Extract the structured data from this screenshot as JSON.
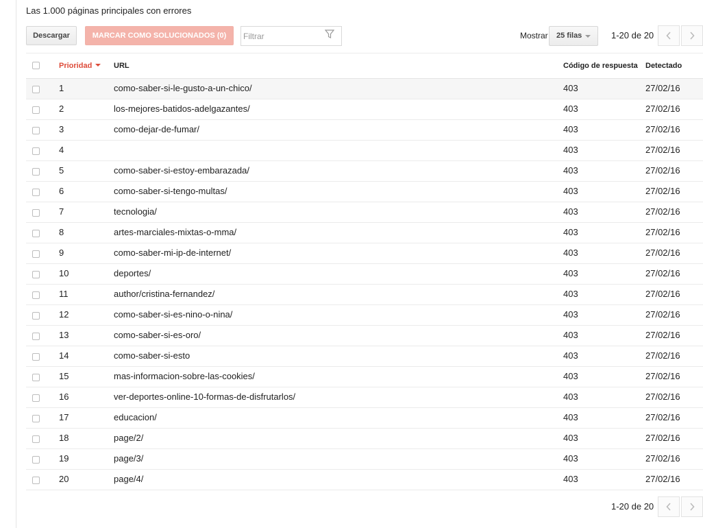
{
  "heading": "Las 1.000 páginas principales con errores",
  "toolbar": {
    "download_label": "Descargar",
    "mark_fixed_label": "MARCAR COMO SOLUCIONADOS (0)",
    "filter_placeholder": "Filtrar",
    "show_label": "Mostrar",
    "rows_value": "25 filas",
    "page_info": "1-20 de 20"
  },
  "table": {
    "headers": {
      "priority": "Prioridad",
      "url": "URL",
      "code": "Código de respuesta",
      "detected": "Detectado"
    },
    "rows": [
      {
        "priority": "1",
        "url": "como-saber-si-le-gusto-a-un-chico/",
        "code": "403",
        "detected": "27/02/16"
      },
      {
        "priority": "2",
        "url": "los-mejores-batidos-adelgazantes/",
        "code": "403",
        "detected": "27/02/16"
      },
      {
        "priority": "3",
        "url": "como-dejar-de-fumar/",
        "code": "403",
        "detected": "27/02/16"
      },
      {
        "priority": "4",
        "url": "",
        "code": "403",
        "detected": "27/02/16"
      },
      {
        "priority": "5",
        "url": "como-saber-si-estoy-embarazada/",
        "code": "403",
        "detected": "27/02/16"
      },
      {
        "priority": "6",
        "url": "como-saber-si-tengo-multas/",
        "code": "403",
        "detected": "27/02/16"
      },
      {
        "priority": "7",
        "url": "tecnologia/",
        "code": "403",
        "detected": "27/02/16"
      },
      {
        "priority": "8",
        "url": "artes-marciales-mixtas-o-mma/",
        "code": "403",
        "detected": "27/02/16"
      },
      {
        "priority": "9",
        "url": "como-saber-mi-ip-de-internet/",
        "code": "403",
        "detected": "27/02/16"
      },
      {
        "priority": "10",
        "url": "deportes/",
        "code": "403",
        "detected": "27/02/16"
      },
      {
        "priority": "11",
        "url": "author/cristina-fernandez/",
        "code": "403",
        "detected": "27/02/16"
      },
      {
        "priority": "12",
        "url": "como-saber-si-es-nino-o-nina/",
        "code": "403",
        "detected": "27/02/16"
      },
      {
        "priority": "13",
        "url": "como-saber-si-es-oro/",
        "code": "403",
        "detected": "27/02/16"
      },
      {
        "priority": "14",
        "url": "como-saber-si-esto",
        "code": "403",
        "detected": "27/02/16"
      },
      {
        "priority": "15",
        "url": "mas-informacion-sobre-las-cookies/",
        "code": "403",
        "detected": "27/02/16"
      },
      {
        "priority": "16",
        "url": "ver-deportes-online-10-formas-de-disfrutarlos/",
        "code": "403",
        "detected": "27/02/16"
      },
      {
        "priority": "17",
        "url": "educacion/",
        "code": "403",
        "detected": "27/02/16"
      },
      {
        "priority": "18",
        "url": "page/2/",
        "code": "403",
        "detected": "27/02/16"
      },
      {
        "priority": "19",
        "url": "page/3/",
        "code": "403",
        "detected": "27/02/16"
      },
      {
        "priority": "20",
        "url": "page/4/",
        "code": "403",
        "detected": "27/02/16"
      }
    ]
  },
  "footer": {
    "page_info": "1-20 de 20"
  },
  "colors": {
    "accent_red": "#dd4b39",
    "mark_button_bg": "#f4b3aa"
  },
  "icons": [
    "funnel-icon",
    "sort-caret-icon",
    "chevron-left-icon",
    "chevron-right-icon"
  ]
}
